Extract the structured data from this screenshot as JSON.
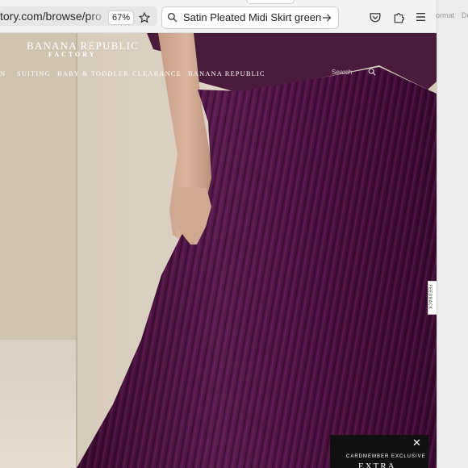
{
  "browser": {
    "url_text": "tory.com/browse/product",
    "zoom": "67%",
    "search_query": "Satin Pleated Midi Skirt green"
  },
  "side_strip": {
    "label1": "ormat",
    "label2": "Do"
  },
  "site": {
    "logo_line1": "BANANA REPUBLIC",
    "logo_line2": "FACTORY",
    "nav": [
      "N",
      "SUITING",
      "BABY & TODDLER",
      "CLEARANCE",
      "BANANA REPUBLIC"
    ],
    "search_placeholder": "Search"
  },
  "feedback_label": "FEEDBACK",
  "promo": {
    "line1": "CARDMEMBER EXCLUSIVE",
    "line2": "EXTRA",
    "close": "✕"
  },
  "colors": {
    "skirt": "#4a0f3e",
    "backdrop": "#d8cdbf",
    "toolbar": "#f3f3f3"
  }
}
